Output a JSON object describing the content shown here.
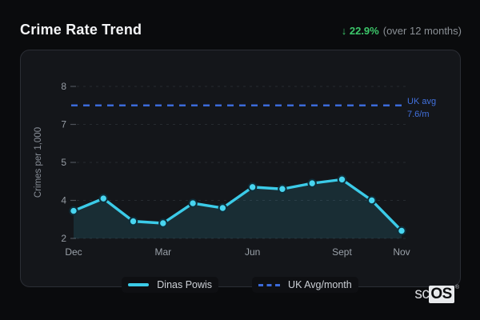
{
  "header": {
    "title": "Crime Rate Trend",
    "delta_arrow": "↓",
    "delta_value": "22.9%",
    "delta_note": "(over 12 months)",
    "delta_color": "#3cc76a"
  },
  "chart_data": {
    "type": "line",
    "title": "Crime Rate Trend",
    "ylabel": "Crimes per 1,000",
    "xlabel": "",
    "grid": "horizontal-dashed",
    "legend_position": "bottom",
    "y_tick_labels": [
      "2",
      "4",
      "5",
      "7",
      "8"
    ],
    "y_ticks_evenly_spaced": true,
    "x_point_count": 12,
    "x_ticks": [
      {
        "i": 0,
        "label": "Dec"
      },
      {
        "i": 3,
        "label": "Mar"
      },
      {
        "i": 6,
        "label": "Jun"
      },
      {
        "i": 9,
        "label": "Sept"
      },
      {
        "i": 11,
        "label": "Nov"
      }
    ],
    "series": [
      {
        "name": "Dinas Powis",
        "style": "solid",
        "marker": "circle",
        "color": "#3bcbe8",
        "marker_fill": "#48d5f0",
        "marker_ring": "#0e2e3a",
        "area_fill": "rgba(61,203,232,0.13)",
        "values": [
          3.45,
          4.05,
          2.9,
          2.8,
          3.85,
          3.6,
          4.35,
          4.3,
          4.45,
          4.55,
          4.0,
          2.4
        ]
      },
      {
        "name": "UK Avg/month",
        "style": "dashed",
        "color": "#3b6ad8",
        "label_color": "#4271de",
        "display_value": "7.6/m",
        "annotation_line1": "UK avg",
        "annotation_line2": "7.6/m",
        "plot_value": 7.5
      }
    ],
    "axis_text_color": "#969ca4",
    "gridline_color": "#262a30",
    "tick_mark_color": "#4d525a"
  },
  "legend": {
    "items": [
      {
        "label": "Dinas Powis",
        "color": "#3bcbe8",
        "style": "solid"
      },
      {
        "label": "UK Avg/month",
        "color": "#3b6ad8",
        "style": "dashed"
      }
    ]
  },
  "brand": {
    "prefix": "sc",
    "boxed": "OS",
    "registered": "®"
  }
}
